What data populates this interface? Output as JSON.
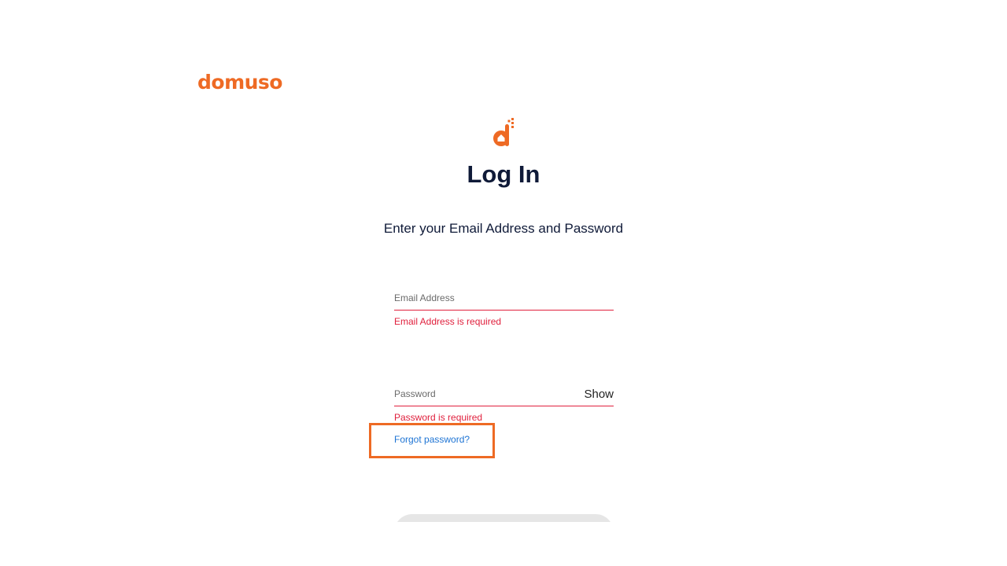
{
  "brand": {
    "logo_text": "domuso",
    "mark_icon": "domuso-d-house-icon",
    "accent_color": "#ee6a24"
  },
  "login": {
    "title": "Log In",
    "subtitle": "Enter your Email Address and Password",
    "email": {
      "placeholder": "Email Address",
      "value": "",
      "error": "Email Address is required"
    },
    "password": {
      "placeholder": "Password",
      "value": "",
      "error": "Password is required",
      "toggle_label": "Show"
    },
    "forgot_label": "Forgot password?",
    "submit_label": ""
  },
  "colors": {
    "title_text": "#0f1a38",
    "error": "#e0203d",
    "link": "#1e74d4",
    "highlight": "#ee6a24",
    "button_disabled": "#e6e6e6"
  }
}
